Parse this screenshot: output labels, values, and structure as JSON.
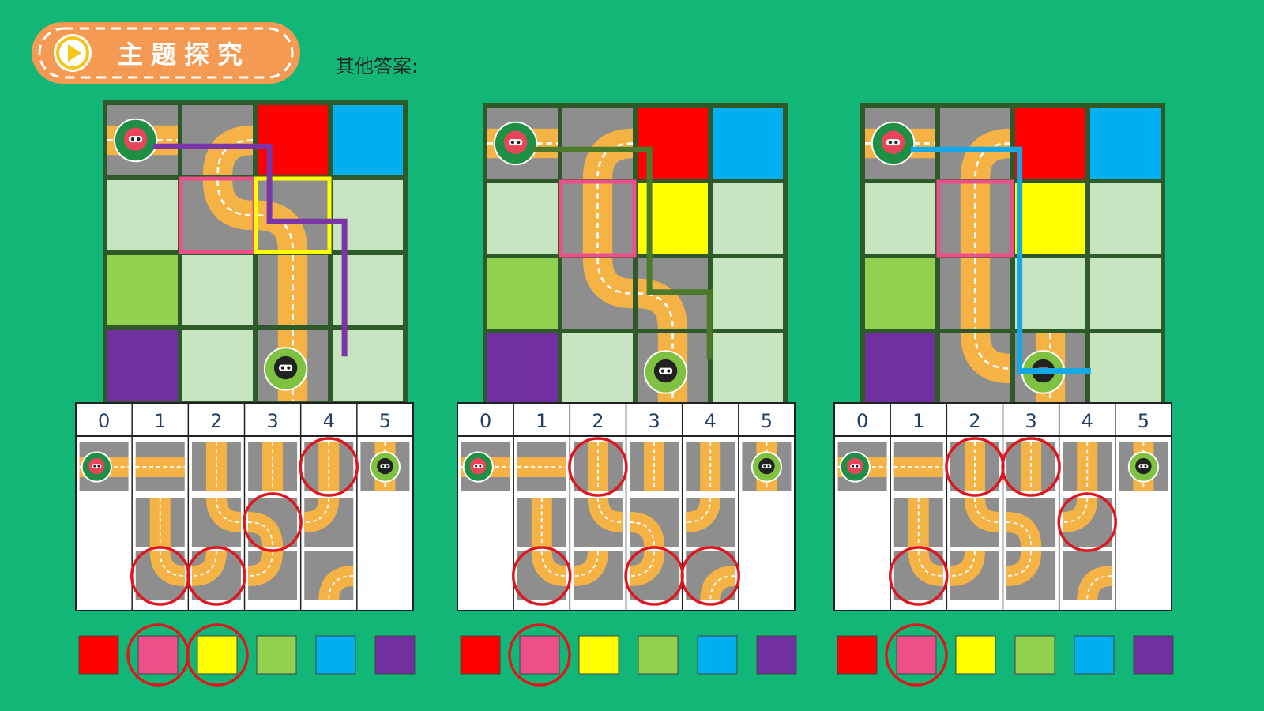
{
  "header": {
    "badge_label": "主题探究",
    "subtitle": "其他答案:"
  },
  "colors": {
    "background": "#12b777",
    "badge_fill": "#f59a52",
    "badge_icon": "#f5c518",
    "board_border": "#2e5a2a",
    "tile_light": "#c6e4bf",
    "road": "#f5b346",
    "asphalt": "#8e8e8e",
    "red": "#ff0000",
    "blue": "#00b0f0",
    "yellow": "#ffff00",
    "lightgreen": "#92d050",
    "purple": "#7030a0",
    "pink": "#ec4f8a",
    "highlight_circle": "#e0161e",
    "path_1": "#7b35a6",
    "path_2": "#4c7a2a",
    "path_3": "#14a8e6"
  },
  "boards": [
    {
      "id": "board-1",
      "path_color": "path_1",
      "cells": [
        [
          "start",
          "curve-right-down",
          "red",
          "blue"
        ],
        [
          "light",
          "curve-down-right",
          "curve-left-down",
          "light"
        ],
        [
          "lightgreen",
          "light",
          "straight-v",
          "light"
        ],
        [
          "purple",
          "light",
          "end",
          "light"
        ]
      ],
      "highlights": [
        {
          "row": 1,
          "col": 1,
          "color": "pink"
        },
        {
          "row": 1,
          "col": 2,
          "color": "yellow"
        }
      ],
      "path": [
        [
          0,
          0.55
        ],
        [
          1.55,
          0.55
        ],
        [
          1.55,
          1.55
        ],
        [
          2.55,
          1.55
        ],
        [
          2.55,
          3.35
        ]
      ],
      "table": {
        "columns": [
          "0",
          "1",
          "2",
          "3",
          "4",
          "5"
        ],
        "tiles": [
          [
            "start",
            "straight-h",
            "straight-v",
            "straight-v",
            "straight-v",
            "end"
          ],
          [
            "",
            "straight-v",
            "curve-a",
            "curve-b",
            "curve-c",
            ""
          ],
          [
            "",
            "curve-a",
            "curve-c",
            "curve-c",
            "curve-d",
            ""
          ]
        ],
        "circles": [
          [
            0,
            4
          ],
          [
            1,
            3
          ],
          [
            2,
            1
          ],
          [
            2,
            2
          ]
        ]
      },
      "swatches": [
        "red",
        "pink",
        "yellow",
        "lightgreen",
        "blue",
        "purple"
      ],
      "swatch_circles": [
        1,
        2
      ]
    },
    {
      "id": "board-2",
      "path_color": "path_2",
      "cells": [
        [
          "start",
          "curve-right-down",
          "red",
          "blue"
        ],
        [
          "light",
          "straight-v",
          "yellow",
          "light"
        ],
        [
          "lightgreen",
          "curve-down-right",
          "curve-left-down",
          "light"
        ],
        [
          "purple",
          "light",
          "end",
          "light"
        ]
      ],
      "highlights": [
        {
          "row": 1,
          "col": 1,
          "color": "pink"
        }
      ],
      "path": [
        [
          0,
          0.55
        ],
        [
          1.55,
          0.55
        ],
        [
          1.55,
          2.45
        ],
        [
          2.35,
          2.45
        ],
        [
          2.35,
          3.35
        ]
      ],
      "table": {
        "columns": [
          "0",
          "1",
          "2",
          "3",
          "4",
          "5"
        ],
        "tiles": [
          [
            "start",
            "straight-h",
            "straight-v",
            "straight-v",
            "straight-v",
            "end"
          ],
          [
            "",
            "straight-v",
            "curve-a",
            "curve-b",
            "curve-c",
            ""
          ],
          [
            "",
            "curve-a",
            "curve-c",
            "curve-c",
            "curve-d",
            ""
          ]
        ],
        "circles": [
          [
            0,
            2
          ],
          [
            2,
            1
          ],
          [
            2,
            3
          ],
          [
            2,
            4
          ]
        ]
      },
      "swatches": [
        "red",
        "pink",
        "yellow",
        "lightgreen",
        "blue",
        "purple"
      ],
      "swatch_circles": [
        1
      ]
    },
    {
      "id": "board-3",
      "path_color": "path_3",
      "cells": [
        [
          "start",
          "curve-right-down",
          "red",
          "blue"
        ],
        [
          "light",
          "straight-v",
          "yellow",
          "light"
        ],
        [
          "lightgreen",
          "straight-v",
          "light",
          "light"
        ],
        [
          "purple",
          "curve-down-right",
          "end",
          "light"
        ]
      ],
      "highlights": [
        {
          "row": 1,
          "col": 1,
          "color": "pink"
        }
      ],
      "path": [
        [
          0,
          0.55
        ],
        [
          1.45,
          0.55
        ],
        [
          1.45,
          3.5
        ],
        [
          2.4,
          3.5
        ]
      ],
      "table": {
        "columns": [
          "0",
          "1",
          "2",
          "3",
          "4",
          "5"
        ],
        "tiles": [
          [
            "start",
            "straight-h",
            "straight-v",
            "straight-v",
            "straight-v",
            "end"
          ],
          [
            "",
            "straight-v",
            "curve-a",
            "curve-b",
            "curve-c",
            ""
          ],
          [
            "",
            "curve-a",
            "curve-c",
            "curve-c",
            "curve-d",
            ""
          ]
        ],
        "circles": [
          [
            0,
            2
          ],
          [
            0,
            3
          ],
          [
            1,
            4
          ],
          [
            2,
            1
          ]
        ]
      },
      "swatches": [
        "red",
        "pink",
        "yellow",
        "lightgreen",
        "blue",
        "purple"
      ],
      "swatch_circles": [
        1
      ]
    }
  ]
}
